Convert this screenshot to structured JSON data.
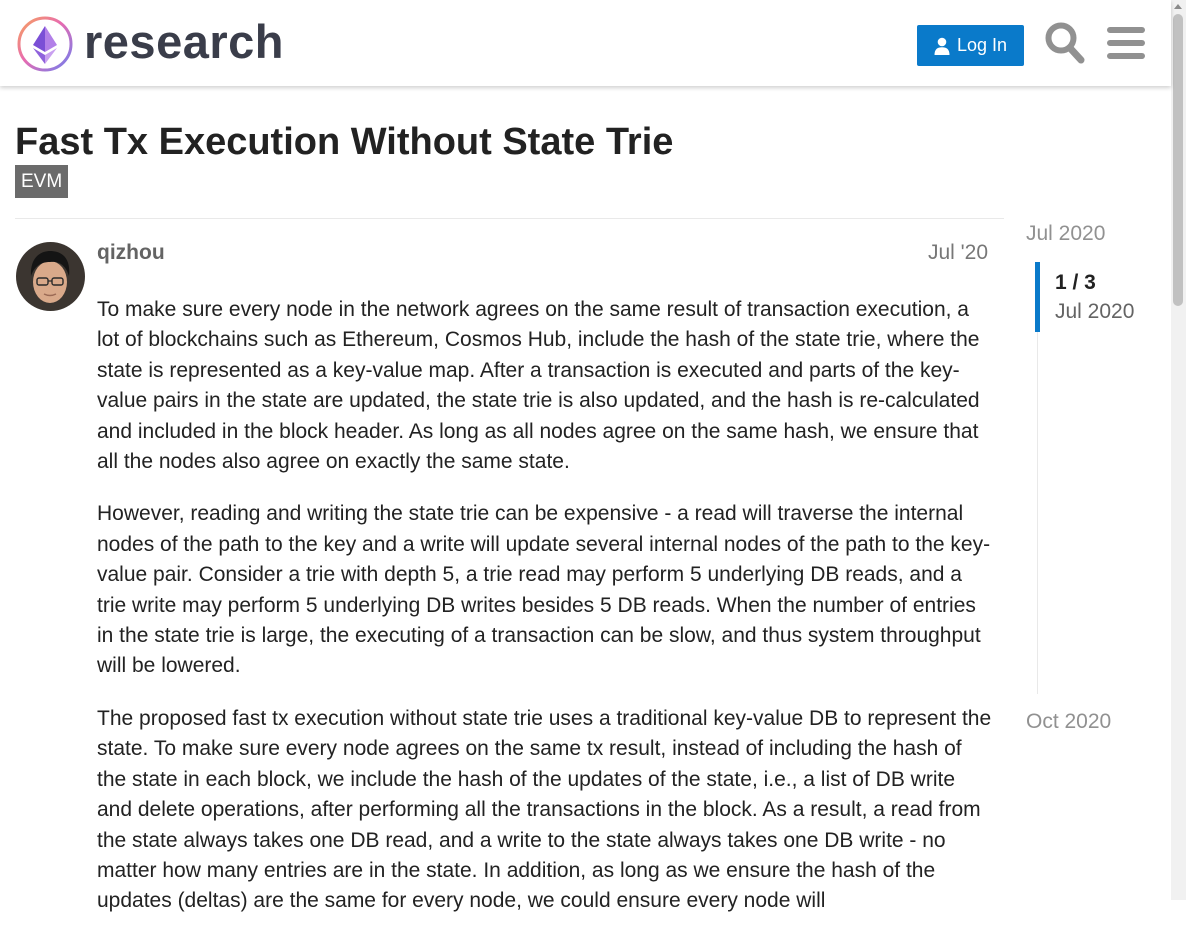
{
  "header": {
    "site_name": "research",
    "login_label": "Log In",
    "accent": "#0a7aca"
  },
  "topic": {
    "title": "Fast Tx Execution Without State Trie",
    "tag": "EVM",
    "tag_color": "#6b6b6b"
  },
  "post": {
    "username": "qizhou",
    "date": "Jul '20",
    "paragraphs": [
      "To make sure every node in the network agrees on the same result of transaction execution, a lot of blockchains such as Ethereum, Cosmos Hub, include the hash of the state trie, where the state is represented as a key-value map. After a transaction is executed and parts of the key-value pairs in the state are updated, the state trie is also updated, and the hash is re-calculated and included in the block header. As long as all nodes agree on the same hash, we ensure that all the nodes also agree on exactly the same state.",
      "However, reading and writing the state trie can be expensive - a read will traverse the internal nodes of the path to the key and a write will update several internal nodes of the path to the key-value pair. Consider a trie with depth 5, a trie read may perform 5 underlying DB reads, and a trie write may perform 5 underlying DB writes besides 5 DB reads. When the number of entries in the state trie is large, the executing of a transaction can be slow, and thus system throughput will be lowered.",
      "The proposed fast tx execution without state trie uses a traditional key-value DB to represent the state. To make sure every node agrees on the same tx result, instead of including the hash of the state in each block, we include the hash of the updates of the state, i.e., a list of DB write and delete operations, after performing all the transactions in the block. As a result, a read from the state always takes one DB read, and a write to the state always takes one DB write - no matter how many entries are in the state. In addition, as long as we ensure the hash of the updates (deltas) are the same for every node, we could ensure every node will"
    ]
  },
  "timeline": {
    "start": "Jul 2020",
    "position": "1 / 3",
    "current_date": "Jul 2020",
    "end": "Oct 2020"
  }
}
